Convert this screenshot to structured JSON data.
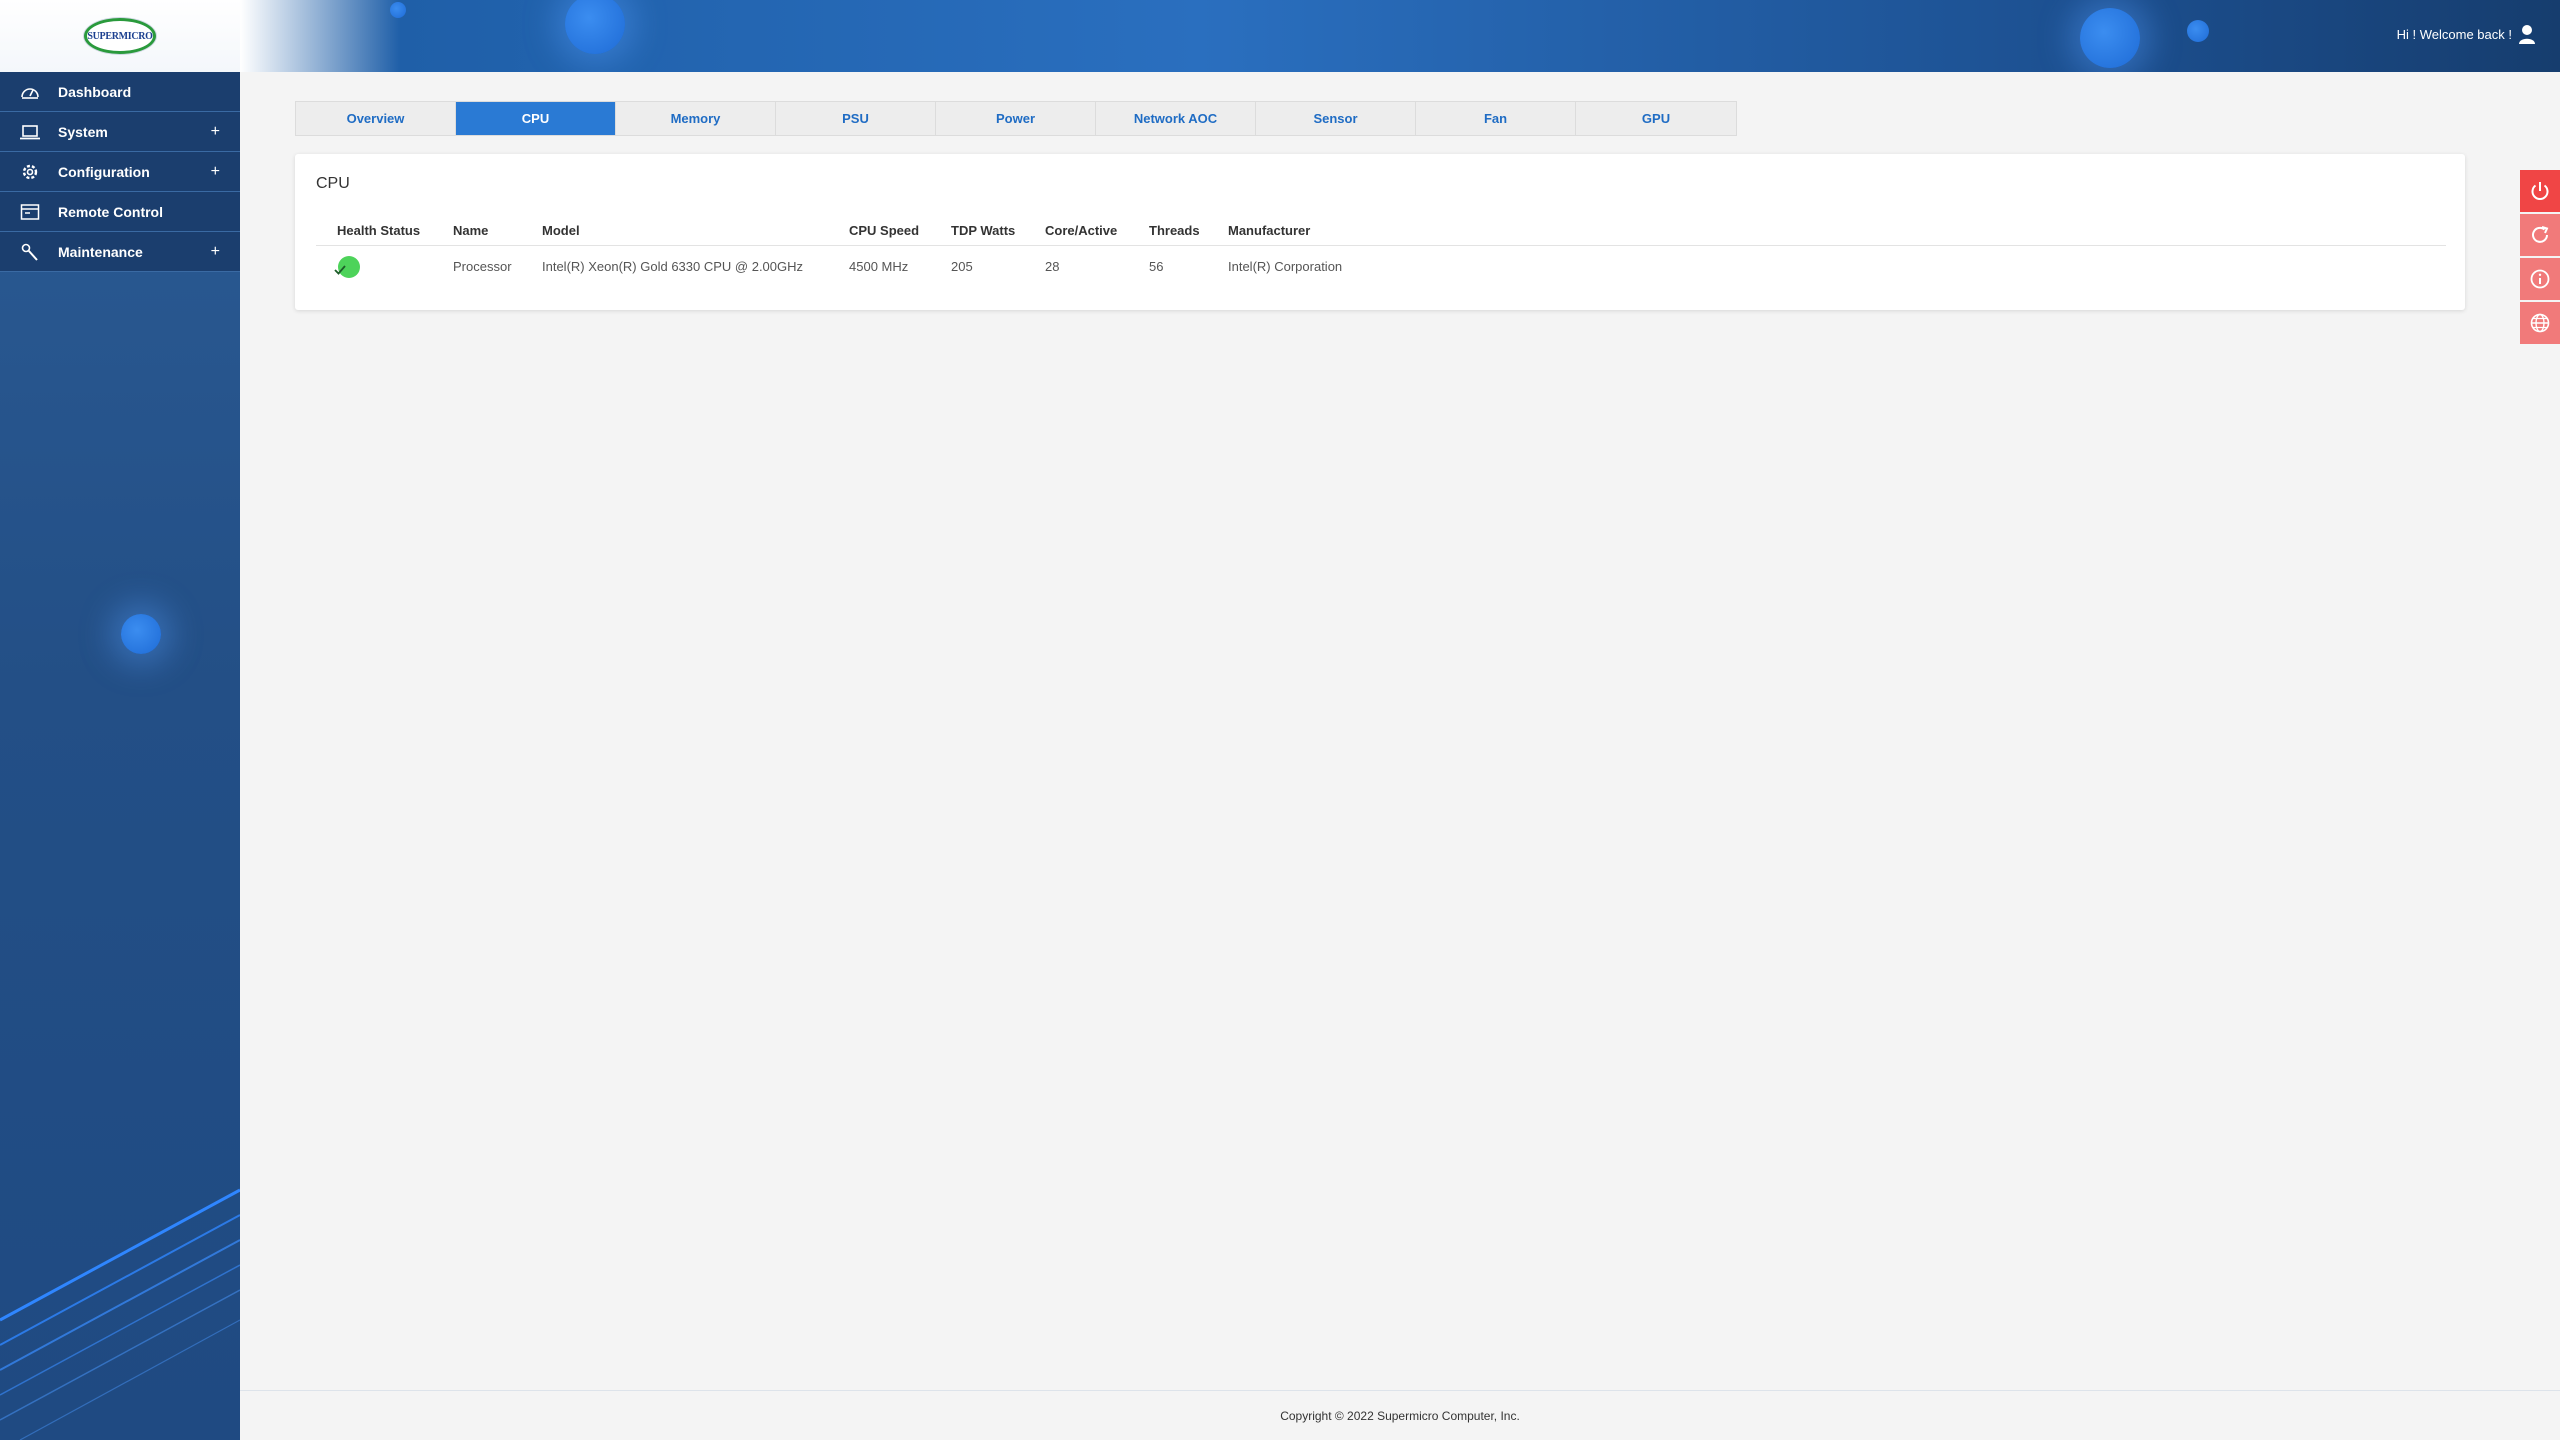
{
  "header": {
    "logo_text": "SUPERMICRO",
    "welcome": "Hi ! Welcome back !"
  },
  "sidebar": {
    "items": [
      {
        "label": "Dashboard",
        "icon": "dashboard-icon",
        "expandable": false
      },
      {
        "label": "System",
        "icon": "laptop-icon",
        "expandable": true
      },
      {
        "label": "Configuration",
        "icon": "gear-icon",
        "expandable": true
      },
      {
        "label": "Remote Control",
        "icon": "console-icon",
        "expandable": false
      },
      {
        "label": "Maintenance",
        "icon": "wrench-icon",
        "expandable": true
      }
    ],
    "expand_symbol": "+"
  },
  "tabs": [
    {
      "label": "Overview",
      "active": false
    },
    {
      "label": "CPU",
      "active": true
    },
    {
      "label": "Memory",
      "active": false
    },
    {
      "label": "PSU",
      "active": false
    },
    {
      "label": "Power",
      "active": false
    },
    {
      "label": "Network AOC",
      "active": false
    },
    {
      "label": "Sensor",
      "active": false
    },
    {
      "label": "Fan",
      "active": false
    },
    {
      "label": "GPU",
      "active": false
    }
  ],
  "cpu_panel": {
    "title": "CPU",
    "columns": [
      "Health Status",
      "Name",
      "Model",
      "CPU Speed",
      "TDP Watts",
      "Core/Active",
      "Threads",
      "Manufacturer"
    ],
    "rows": [
      {
        "health_status": "ok",
        "name": "Processor",
        "model": "Intel(R) Xeon(R) Gold 6330 CPU @ 2.00GHz",
        "cpu_speed": "4500 MHz",
        "tdp_watts": "205",
        "core_active": "28",
        "threads": "56",
        "manufacturer": "Intel(R) Corporation"
      }
    ]
  },
  "actions": [
    {
      "icon": "power-icon"
    },
    {
      "icon": "refresh-icon"
    },
    {
      "icon": "info-icon"
    },
    {
      "icon": "globe-icon"
    }
  ],
  "footer": {
    "copyright": "Copyright © 2022 Supermicro Computer, Inc."
  },
  "colors": {
    "accent": "#2a7ad4",
    "status_ok": "#4dd35a",
    "power_button": "#f04545",
    "action_button": "#f17a7a",
    "sidebar_item_bg": "#1b3e6e"
  }
}
